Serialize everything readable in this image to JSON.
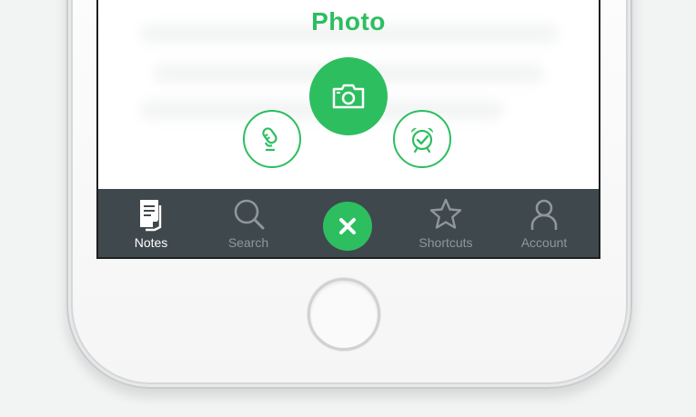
{
  "device": {
    "frame_color": "#f7f7f7",
    "accent": "#2dbe60",
    "tabbar_bg": "#3f484d"
  },
  "menu": {
    "active_label": "Photo",
    "actions": [
      {
        "name": "camera",
        "icon": "camera-icon"
      },
      {
        "name": "audio",
        "icon": "microphone-icon"
      },
      {
        "name": "reminder",
        "icon": "alarm-clock-icon"
      }
    ]
  },
  "tabbar": {
    "tabs": [
      {
        "label": "Notes",
        "icon": "notes-icon",
        "active": true
      },
      {
        "label": "Search",
        "icon": "search-icon",
        "active": false
      },
      {
        "label": "Shortcuts",
        "icon": "star-icon",
        "active": false
      },
      {
        "label": "Account",
        "icon": "person-icon",
        "active": false
      }
    ],
    "center_button_icon": "close-icon"
  },
  "hardware": {
    "home_button": "home-button"
  }
}
